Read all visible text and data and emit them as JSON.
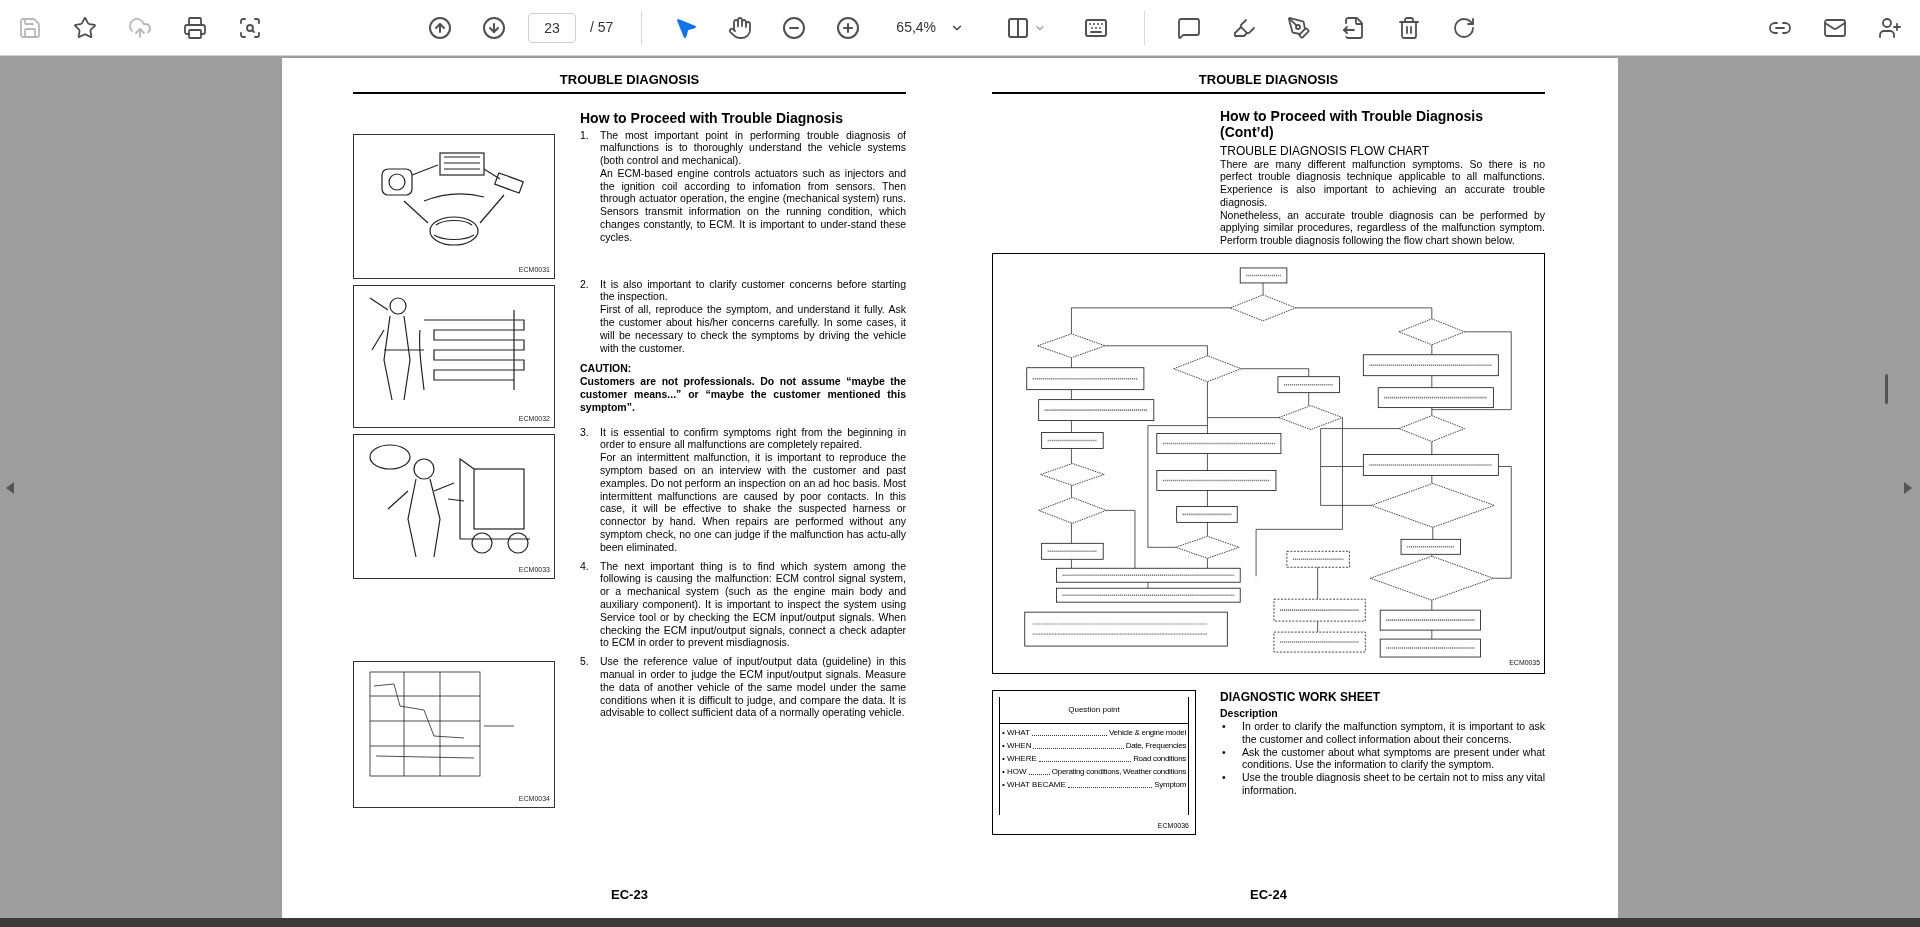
{
  "toolbar": {
    "tools": [
      {
        "kind": "save",
        "disabled": true
      },
      {
        "kind": "bookmark",
        "disabled": false
      },
      {
        "kind": "upload",
        "disabled": true
      },
      {
        "kind": "print",
        "disabled": false
      },
      {
        "kind": "find",
        "disabled": false
      }
    ],
    "page_nav": {
      "current": "23",
      "total": "/ 57"
    },
    "modes": [
      {
        "kind": "select",
        "selected": true
      },
      {
        "kind": "hand",
        "selected": false
      }
    ],
    "zoom": {
      "value": "65,4%"
    },
    "edit_tools": [
      {
        "kind": "comment"
      },
      {
        "kind": "highlight"
      },
      {
        "kind": "sign"
      },
      {
        "kind": "export"
      },
      {
        "kind": "delete"
      },
      {
        "kind": "rotate"
      }
    ],
    "share_tools": [
      {
        "kind": "link"
      },
      {
        "kind": "mail"
      },
      {
        "kind": "add-user"
      }
    ]
  },
  "left_page": {
    "header": "TROUBLE DIAGNOSIS",
    "title": "How to Proceed with Trouble Diagnosis",
    "blocks": [
      {
        "kind": "step",
        "number": "1.",
        "paragraphs": [
          "The most important point in performing trouble diagnosis of malfunctions is to thoroughly understand the vehicle systems (both control and mechanical).",
          "An ECM-based engine controls actuators such as injectors and the ignition coil according to infomation from sensors. Then through actuator operation, the engine (mechanical system) runs. Sensors transmit information on the running condition, which changes constantly, to ECM. It is important to under-stand these cycles."
        ]
      },
      {
        "kind": "step",
        "number": "2.",
        "paragraphs": [
          "It is also important to clarify customer concerns before starting the inspection.",
          "First of all, reproduce the symptom, and understand it fully. Ask the customer about his/her concerns carefully. In some cases, it will be necessary to check the symptoms by driving the vehicle with the customer."
        ]
      },
      {
        "kind": "caution",
        "label": "CAUTION:",
        "text": "Customers are not professionals. Do not assume “maybe the customer means...” or “maybe the customer mentioned this symptom”."
      },
      {
        "kind": "step",
        "number": "3.",
        "paragraphs": [
          "It is essential to confirm symptoms right from the beginning in order to ensure all malfunctions are completely repaired.",
          "For an intermittent malfunction, it is important to reproduce the symptom based on an interview with the customer and past examples. Do not perform an inspection on an ad hoc basis. Most intermittent malfunctions are caused by poor contacts. In this case, it will be effective to shake the suspected harness or connector by hand. When repairs are performed without any symptom check, no one can judge if the malfunction has actu-ally been eliminated."
        ]
      },
      {
        "kind": "step",
        "number": "4.",
        "paragraphs": [
          "The next important thing is to find which system among the following is causing the malfunction: ECM control signal system, or a mechanical system (such as the engine main body and auxiliary component). It is important to inspect the system using Service tool or by checking the ECM input/output signals. When checking the ECM input/output signals, connect a check adapter to ECM in order to prevent misdiagnosis."
        ]
      },
      {
        "kind": "step",
        "number": "5.",
        "paragraphs": [
          "Use the reference value of input/output data (guideline) in this manual in order to judge the ECM input/output signals. Measure the data of another vehicle of the same model under the same conditions when it is difficult to judge, and compare the data. It is advisable to collect sufficient data of a normally operating vehicle."
        ]
      }
    ],
    "figures": [
      {
        "kind": "engine-system",
        "code": "ECM0031"
      },
      {
        "kind": "maze",
        "code": "ECM0032"
      },
      {
        "kind": "forklift",
        "code": "ECM0033"
      },
      {
        "kind": "graph",
        "code": "ECM0034"
      }
    ],
    "page_number": "EC-23"
  },
  "right_page": {
    "header": "TROUBLE DIAGNOSIS",
    "title": "How to Proceed with Trouble Diagnosis (Cont’d)",
    "subtitle": "TROUBLE DIAGNOSIS FLOW CHART",
    "paragraphs": [
      "There are many different malfunction symptoms. So there is no perfect trouble diagnosis technique applicable to all malfunctions. Experience is also important to achieving an accurate trouble diagnosis.",
      "Nonetheless, an accurate trouble diagnosis can be performed by applying similar procedures, regardless of the malfunction symptom. Perform trouble diagnosis following the flow chart shown below."
    ],
    "flowchart": {
      "code": "ECM0035"
    },
    "worksheet_figure": {
      "title": "Question point",
      "rows": [
        {
          "question": "• WHAT",
          "answer": "Vehicle & engine model"
        },
        {
          "question": "• WHEN",
          "answer": "Date, Frequencies"
        },
        {
          "question": "• WHERE",
          "answer": "Road conditions"
        },
        {
          "question": "• HOW",
          "answer": "Operating conditions, Weather conditions"
        },
        {
          "question": "• WHAT BECAME",
          "answer": "Symptom"
        }
      ],
      "code": "ECM0036"
    },
    "bullet_marker": "•",
    "section_title": "DIAGNOSTIC WORK SHEET",
    "section_subtitle": "Description",
    "bullets": [
      "In order to clarify the malfunction symptom, it is important to ask the customer and collect information about their concerns.",
      "Ask the customer about what symptoms are present under what conditions. Use the information to clarify the symptom.",
      "Use the trouble diagnosis sheet to be certain not to miss any vital information."
    ],
    "page_number": "EC-24"
  }
}
